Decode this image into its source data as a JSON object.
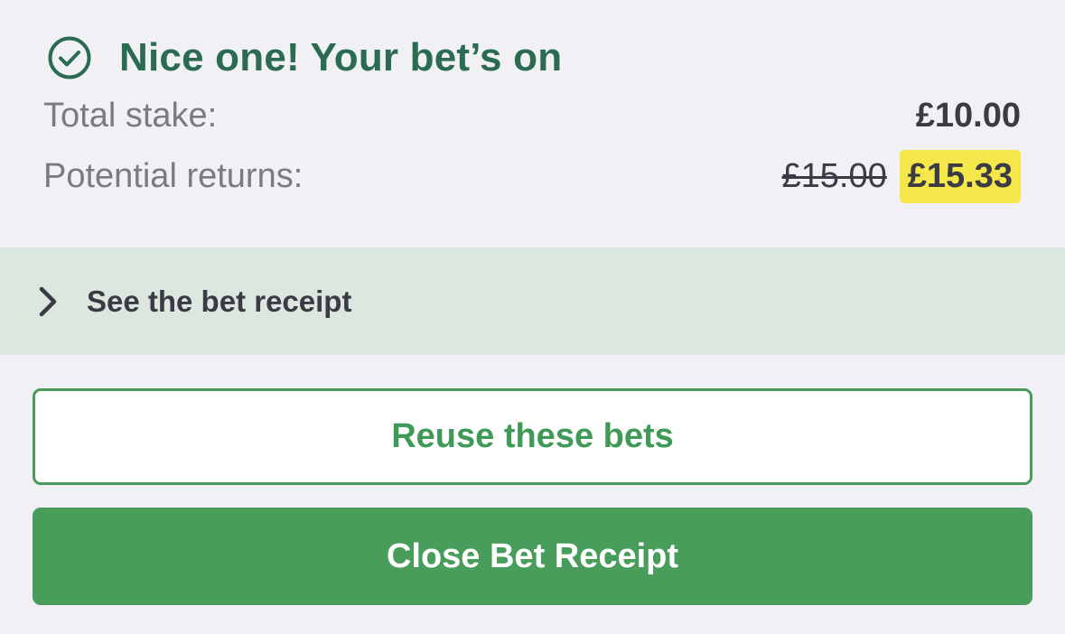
{
  "confirmation": {
    "icon": "check-circle-icon",
    "title": "Nice one! Your bet’s on"
  },
  "summary": {
    "stake_label": "Total stake:",
    "stake_value": "£10.00",
    "returns_label": "Potential returns:",
    "returns_old_value": "£15.00",
    "returns_new_value": "£15.33"
  },
  "receipt": {
    "icon": "chevron-right-icon",
    "label": "See the bet receipt"
  },
  "actions": {
    "reuse_label": "Reuse these bets",
    "close_label": "Close Bet Receipt"
  },
  "colors": {
    "accent_green": "#479d59",
    "title_green": "#2a6b52",
    "highlight_yellow": "#f5e64a",
    "receipt_bar_bg": "#dce8df",
    "page_bg": "#f0f0f5"
  }
}
